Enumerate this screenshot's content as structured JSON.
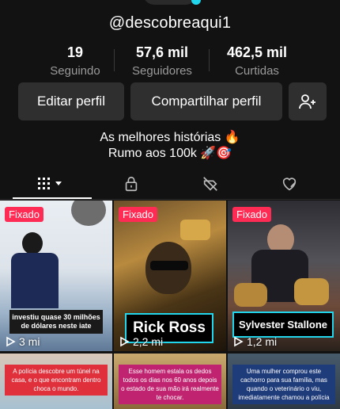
{
  "profile": {
    "username": "@descobreaqui1",
    "bio_line1": "As melhores histórias 🔥",
    "bio_line2": "Rumo aos 100k 🚀🎯"
  },
  "stats": [
    {
      "value": "19",
      "label": "Seguindo"
    },
    {
      "value": "57,6 mil",
      "label": "Seguidores"
    },
    {
      "value": "462,5 mil",
      "label": "Curtidas"
    }
  ],
  "actions": {
    "edit_label": "Editar perfil",
    "share_label": "Compartilhar perfil",
    "add_friend_icon": "add-user-icon"
  },
  "tabs": [
    {
      "icon": "grid-icon",
      "active": true
    },
    {
      "icon": "lock-icon",
      "active": false
    },
    {
      "icon": "saved-icon",
      "active": false
    },
    {
      "icon": "liked-icon",
      "active": false
    }
  ],
  "videos": [
    {
      "pinned": true,
      "pin_label": "Fixado",
      "views": "3 mi",
      "caption": "investiu quase 30 milhões de dólares neste iate"
    },
    {
      "pinned": true,
      "pin_label": "Fixado",
      "views": "2,2 mi",
      "caption": "Rick Ross"
    },
    {
      "pinned": true,
      "pin_label": "Fixado",
      "views": "1,2 mi",
      "caption": "Sylvester Stallone"
    },
    {
      "pinned": false,
      "caption": "A polícia descobre um túnel na casa, e o que encontram dentro choca o mundo."
    },
    {
      "pinned": false,
      "caption": "Esse homem estala os dedos todos os dias nos 60 anos depois o estado de sua mão irá realmente te chocar."
    },
    {
      "pinned": false,
      "caption": "Uma mulher comprou este cachorro para sua família, mas quando o veterinário o viu, imediatamente chamou a polícia"
    }
  ],
  "colors": {
    "background": "#121212",
    "button": "#2f2f2f",
    "pin": "#fe2c55",
    "accent": "#20d5ec"
  }
}
